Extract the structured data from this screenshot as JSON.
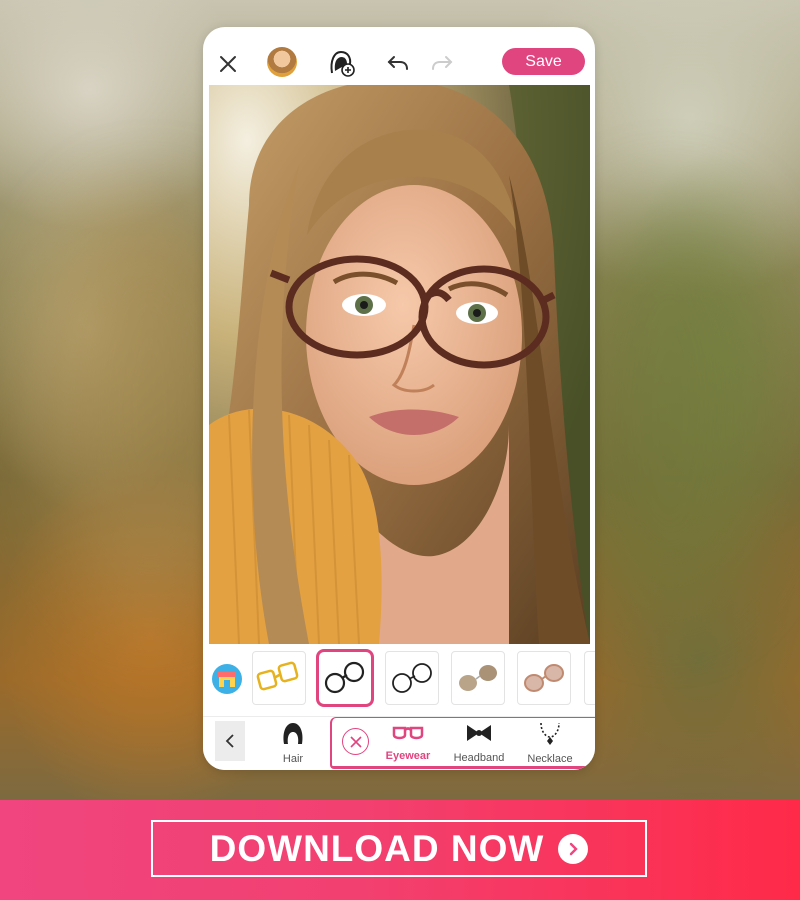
{
  "toolbar": {
    "save_label": "Save",
    "icons": [
      "close-icon",
      "avatar-icon",
      "add-face-icon",
      "undo-icon",
      "redo-icon"
    ]
  },
  "photo": {
    "subject": "portrait-woman-with-glasses"
  },
  "thumbnails": {
    "selected_index": 1,
    "items": [
      "yellow-glasses",
      "black-round-glasses",
      "black-rimless-glasses",
      "brown-sunglasses",
      "pink-sunglasses"
    ]
  },
  "categories": {
    "back_icon": "chevron-left-icon",
    "items": [
      {
        "label": "Hair",
        "icon": "hair-icon"
      },
      {
        "label": "Eyewear",
        "icon": "glasses-icon",
        "active": true
      },
      {
        "label": "Headband",
        "icon": "bow-icon"
      },
      {
        "label": "Necklace",
        "icon": "necklace-icon"
      }
    ]
  },
  "banner": {
    "label": "DOWNLOAD NOW",
    "icon": "chevron-right-circle-icon"
  },
  "colors": {
    "accent": "#e0457f",
    "banner_start": "#f0457f",
    "banner_end": "#ff2a48"
  }
}
